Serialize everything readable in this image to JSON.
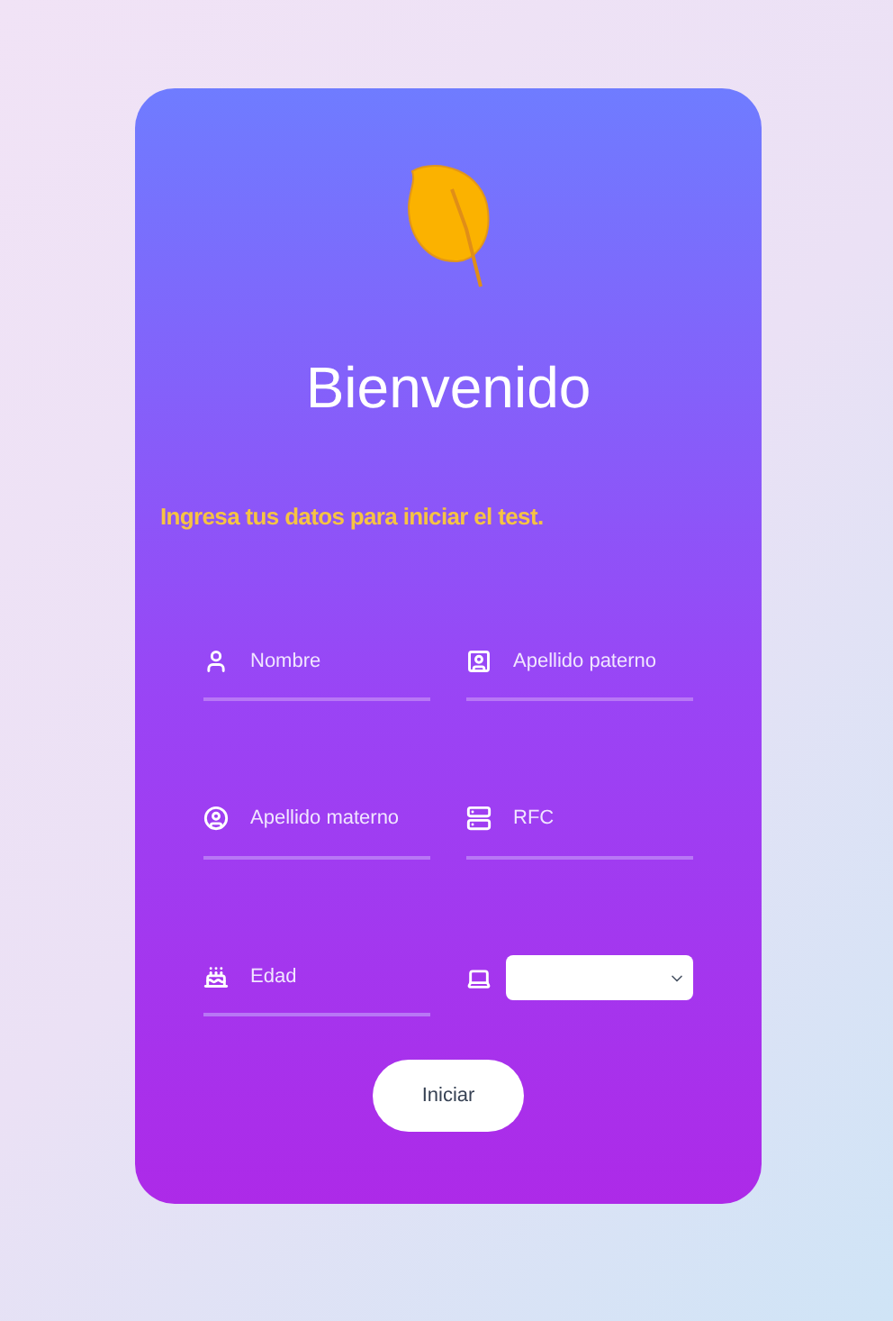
{
  "title": "Bienvenido",
  "subtitle": "Ingresa tus datos para iniciar el test.",
  "fields": [
    {
      "kind": "input",
      "placeholder": "Nombre"
    },
    {
      "kind": "input",
      "placeholder": "Apellido paterno"
    },
    {
      "kind": "input",
      "placeholder": "Apellido materno"
    },
    {
      "kind": "input",
      "placeholder": "RFC"
    },
    {
      "kind": "input",
      "placeholder": "Edad"
    },
    {
      "kind": "select"
    }
  ],
  "submit": "Iniciar"
}
